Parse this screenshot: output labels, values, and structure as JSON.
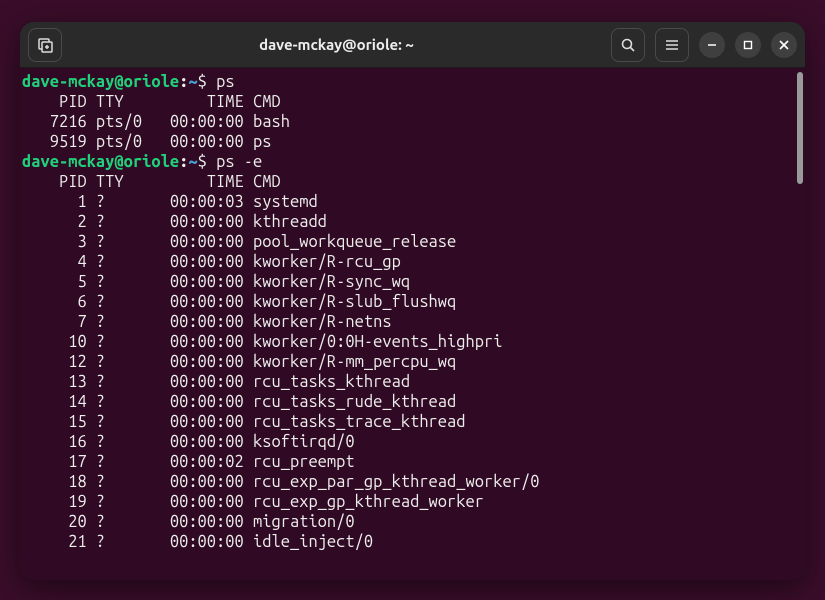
{
  "window": {
    "title": "dave-mckay@oriole: ~"
  },
  "prompt": {
    "user_host": "dave-mckay@oriole",
    "path": "~",
    "symbol": "$"
  },
  "commands": [
    {
      "cmd": "ps"
    },
    {
      "cmd": "ps -e"
    }
  ],
  "header": {
    "pid": "PID",
    "tty": "TTY",
    "time": "TIME",
    "cmd": "CMD"
  },
  "ps_output": [
    {
      "pid": "7216",
      "tty": "pts/0",
      "time": "00:00:00",
      "cmd": "bash"
    },
    {
      "pid": "9519",
      "tty": "pts/0",
      "time": "00:00:00",
      "cmd": "ps"
    }
  ],
  "ps_e_output": [
    {
      "pid": "1",
      "tty": "?",
      "time": "00:00:03",
      "cmd": "systemd"
    },
    {
      "pid": "2",
      "tty": "?",
      "time": "00:00:00",
      "cmd": "kthreadd"
    },
    {
      "pid": "3",
      "tty": "?",
      "time": "00:00:00",
      "cmd": "pool_workqueue_release"
    },
    {
      "pid": "4",
      "tty": "?",
      "time": "00:00:00",
      "cmd": "kworker/R-rcu_gp"
    },
    {
      "pid": "5",
      "tty": "?",
      "time": "00:00:00",
      "cmd": "kworker/R-sync_wq"
    },
    {
      "pid": "6",
      "tty": "?",
      "time": "00:00:00",
      "cmd": "kworker/R-slub_flushwq"
    },
    {
      "pid": "7",
      "tty": "?",
      "time": "00:00:00",
      "cmd": "kworker/R-netns"
    },
    {
      "pid": "10",
      "tty": "?",
      "time": "00:00:00",
      "cmd": "kworker/0:0H-events_highpri"
    },
    {
      "pid": "12",
      "tty": "?",
      "time": "00:00:00",
      "cmd": "kworker/R-mm_percpu_wq"
    },
    {
      "pid": "13",
      "tty": "?",
      "time": "00:00:00",
      "cmd": "rcu_tasks_kthread"
    },
    {
      "pid": "14",
      "tty": "?",
      "time": "00:00:00",
      "cmd": "rcu_tasks_rude_kthread"
    },
    {
      "pid": "15",
      "tty": "?",
      "time": "00:00:00",
      "cmd": "rcu_tasks_trace_kthread"
    },
    {
      "pid": "16",
      "tty": "?",
      "time": "00:00:00",
      "cmd": "ksoftirqd/0"
    },
    {
      "pid": "17",
      "tty": "?",
      "time": "00:00:02",
      "cmd": "rcu_preempt"
    },
    {
      "pid": "18",
      "tty": "?",
      "time": "00:00:00",
      "cmd": "rcu_exp_par_gp_kthread_worker/0"
    },
    {
      "pid": "19",
      "tty": "?",
      "time": "00:00:00",
      "cmd": "rcu_exp_gp_kthread_worker"
    },
    {
      "pid": "20",
      "tty": "?",
      "time": "00:00:00",
      "cmd": "migration/0"
    },
    {
      "pid": "21",
      "tty": "?",
      "time": "00:00:00",
      "cmd": "idle_inject/0"
    }
  ]
}
